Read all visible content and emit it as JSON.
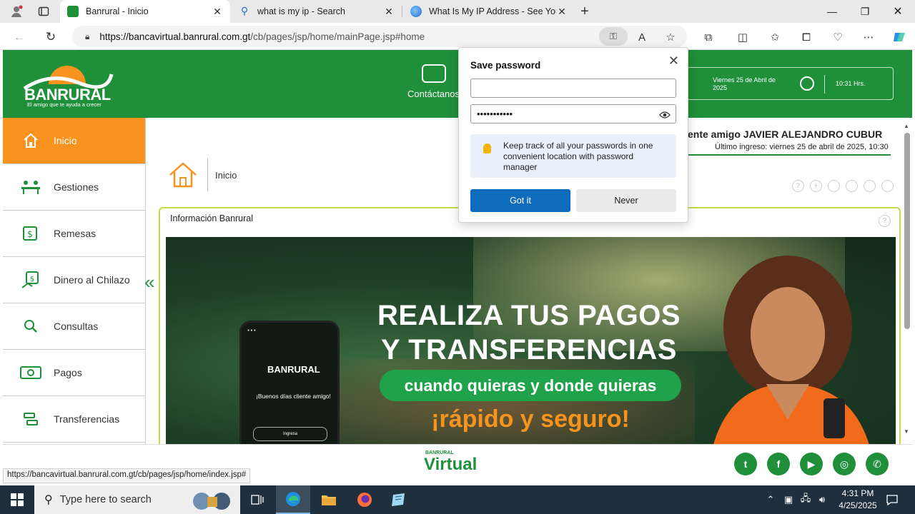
{
  "browser": {
    "tabs": [
      {
        "title": "Banrural - Inicio",
        "active": true
      },
      {
        "title": "what is my ip - Search",
        "active": false
      },
      {
        "title": "What Is My IP Address - See Your",
        "active": false
      }
    ],
    "url_host": "https://bancavirtual.banrural.com.gt",
    "url_path": "/cb/pages/jsp/home/mainPage.jsp#home",
    "status_url": "https://bancavirtual.banrural.com.gt/cb/pages/jsp/home/index.jsp#"
  },
  "site": {
    "logo_name": "BANRURAL",
    "logo_tagline": "El amigo que te ayuda a crecer",
    "contact_label": "Contáctanos",
    "date": "Viernes 25 de Abril de 2025",
    "time": "10:31 Hrs.",
    "welcome": "ente amigo JAVIER ALEJANDRO CUBUR",
    "last_login": "Último ingreso: viernes 25 de abril de 2025, 10:30",
    "breadcrumb": "Inicio",
    "panel_title": "Información Banrural",
    "sidebar": [
      {
        "label": "Inicio",
        "icon": "home-icon"
      },
      {
        "label": "Gestiones",
        "icon": "people-desk-icon"
      },
      {
        "label": "Remesas",
        "icon": "money-stack-icon"
      },
      {
        "label": "Dinero al Chilazo",
        "icon": "cash-hand-icon"
      },
      {
        "label": "Consultas",
        "icon": "search-icon"
      },
      {
        "label": "Pagos",
        "icon": "banknote-icon"
      },
      {
        "label": "Transferencias",
        "icon": "transfer-icon"
      }
    ],
    "banner": {
      "headline1": "REALIZA TUS PAGOS",
      "headline2": "Y TRANSFERENCIAS",
      "pill": "cuando quieras y donde quieras",
      "slogan": "¡rápido y seguro!",
      "phone_brand": "BANRURAL",
      "phone_greeting": "¡Buenos días cliente amigo!",
      "phone_button": "Ingresa"
    },
    "footer_brand": "Virtual",
    "footer_brand_small": "BANRURAL",
    "social": [
      "twitter-icon",
      "facebook-icon",
      "youtube-icon",
      "instagram-icon",
      "whatsapp-icon"
    ]
  },
  "popup": {
    "title": "Save password",
    "username_value": "",
    "password_value": "•••••••••••",
    "tip": "Keep track of all your passwords in one convenient location with password manager",
    "primary": "Got it",
    "secondary": "Never"
  },
  "taskbar": {
    "search_placeholder": "Type here to search",
    "time": "4:31 PM",
    "date": "4/25/2025"
  },
  "colors": {
    "brand_green": "#1f8f3a",
    "accent_orange": "#f7931e",
    "edge_blue": "#0f6cbd"
  }
}
